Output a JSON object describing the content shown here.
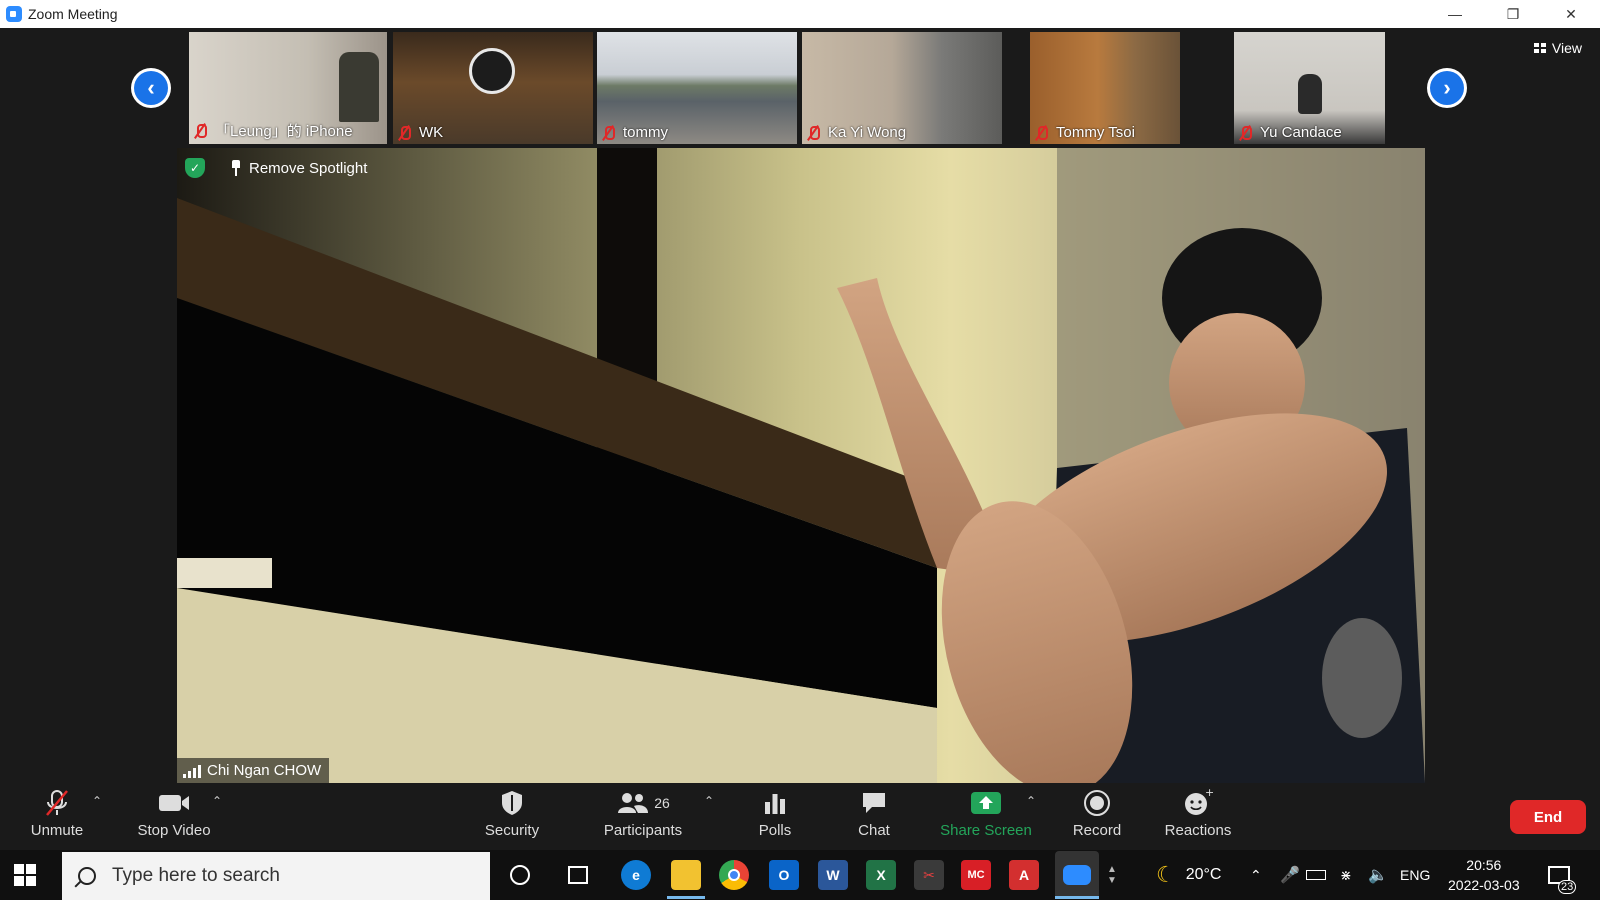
{
  "window": {
    "title": "Zoom Meeting",
    "controls": [
      "minimize",
      "restore",
      "close"
    ]
  },
  "gallery": {
    "view_label": "View",
    "participants": [
      {
        "name": "「Leung」的 iPhone",
        "muted": true,
        "bg": "#b8b2a6"
      },
      {
        "name": "WK",
        "muted": true,
        "bg": "#6b4a2a"
      },
      {
        "name": "tommy",
        "muted": true,
        "bg": "#7d8a99"
      },
      {
        "name": "Ka Yi Wong",
        "muted": true,
        "bg": "#a59a8c"
      },
      {
        "name": "Tommy Tsoi",
        "muted": true,
        "bg": "#8c5a2c"
      },
      {
        "name": "Yu Candace",
        "muted": true,
        "bg": "#c8c4bc"
      }
    ]
  },
  "main": {
    "remove_spotlight": "Remove Spotlight",
    "speaker_name": "Chi Ngan CHOW"
  },
  "toolbar": {
    "unmute": "Unmute",
    "stop_video": "Stop Video",
    "security": "Security",
    "participants": "Participants",
    "participants_count": "26",
    "polls": "Polls",
    "chat": "Chat",
    "share_screen": "Share Screen",
    "record": "Record",
    "reactions": "Reactions",
    "end": "End"
  },
  "taskbar": {
    "search_placeholder": "Type here to search",
    "weather": "20°C",
    "language": "ENG",
    "time": "20:56",
    "date": "2022-03-03",
    "notifications": "23"
  },
  "colors": {
    "accent": "#1a73e8",
    "end_red": "#e02828",
    "share_green": "#23a55a"
  }
}
